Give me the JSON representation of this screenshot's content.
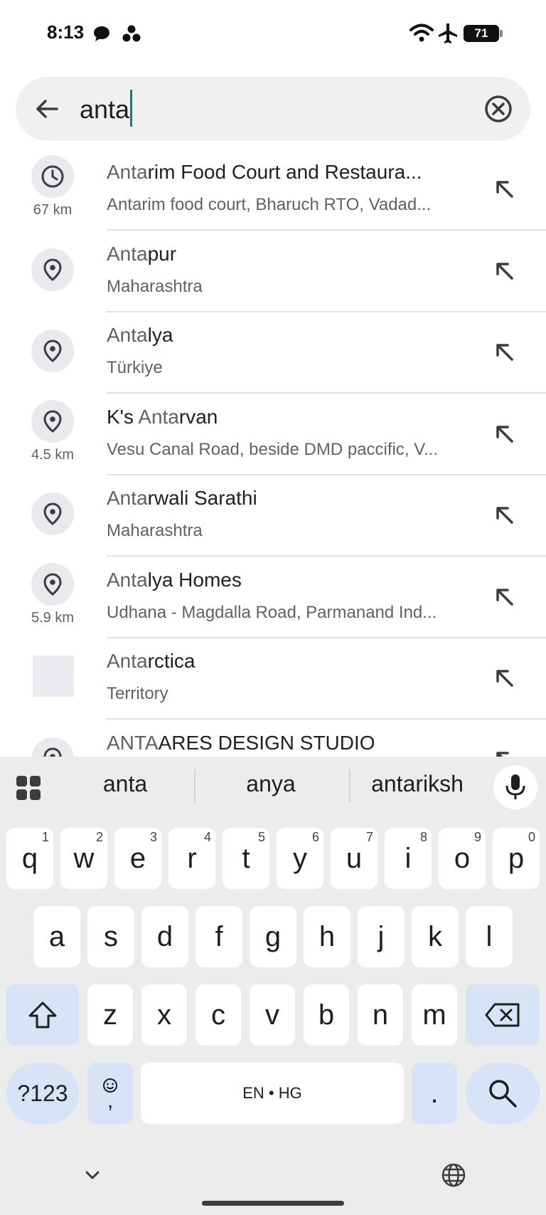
{
  "status_bar": {
    "time": "8:13",
    "battery": "71"
  },
  "search": {
    "query": "anta"
  },
  "results": [
    {
      "title_hl": "Anta",
      "title_rest": "rim Food Court and Restaura...",
      "subtitle": "Antarim food court, Bharuch RTO, Vadad...",
      "distance": "67 km",
      "icon": "history-icon"
    },
    {
      "title_hl": "Anta",
      "title_rest": "pur",
      "subtitle": "Maharashtra",
      "distance": "",
      "icon": "place-pin-icon"
    },
    {
      "title_hl": "Anta",
      "title_rest": "lya",
      "subtitle": "Türkiye",
      "distance": "",
      "icon": "place-pin-icon"
    },
    {
      "title_pre": "K's ",
      "title_hl": "Anta",
      "title_rest": "rvan",
      "subtitle": "Vesu Canal Road, beside DMD paccific, V...",
      "distance": "4.5 km",
      "icon": "place-pin-icon"
    },
    {
      "title_hl": "Anta",
      "title_rest": "rwali Sarathi",
      "subtitle": "Maharashtra",
      "distance": "",
      "icon": "place-pin-icon"
    },
    {
      "title_hl": "Anta",
      "title_rest": "lya Homes",
      "subtitle": "Udhana - Magdalla Road, Parmanand Ind...",
      "distance": "5.9 km",
      "icon": "place-pin-icon"
    },
    {
      "title_hl": "Anta",
      "title_rest": "rctica",
      "subtitle": "Territory",
      "distance": "",
      "icon": "territory-image"
    },
    {
      "title_hl": "ANTA",
      "title_rest": "ARES DESIGN STUDIO",
      "subtitle": "",
      "distance": "",
      "icon": "place-pin-icon"
    }
  ],
  "keyboard": {
    "suggestions": [
      "anta",
      "anya",
      "antariksh"
    ],
    "row1": [
      {
        "k": "q",
        "h": "1"
      },
      {
        "k": "w",
        "h": "2"
      },
      {
        "k": "e",
        "h": "3"
      },
      {
        "k": "r",
        "h": "4"
      },
      {
        "k": "t",
        "h": "5"
      },
      {
        "k": "y",
        "h": "6"
      },
      {
        "k": "u",
        "h": "7"
      },
      {
        "k": "i",
        "h": "8"
      },
      {
        "k": "o",
        "h": "9"
      },
      {
        "k": "p",
        "h": "0"
      }
    ],
    "row2": [
      "a",
      "s",
      "d",
      "f",
      "g",
      "h",
      "j",
      "k",
      "l"
    ],
    "row3": [
      "z",
      "x",
      "c",
      "v",
      "b",
      "n",
      "m"
    ],
    "num_key": "?123",
    "comma_key": ",",
    "space_label": "EN • HG",
    "period_key": "."
  },
  "colors": {
    "caret": "#0b7a8a",
    "special_key": "#d7e3f6",
    "keyboard_bg": "#ececec",
    "search_bg": "#f0f0f0"
  }
}
